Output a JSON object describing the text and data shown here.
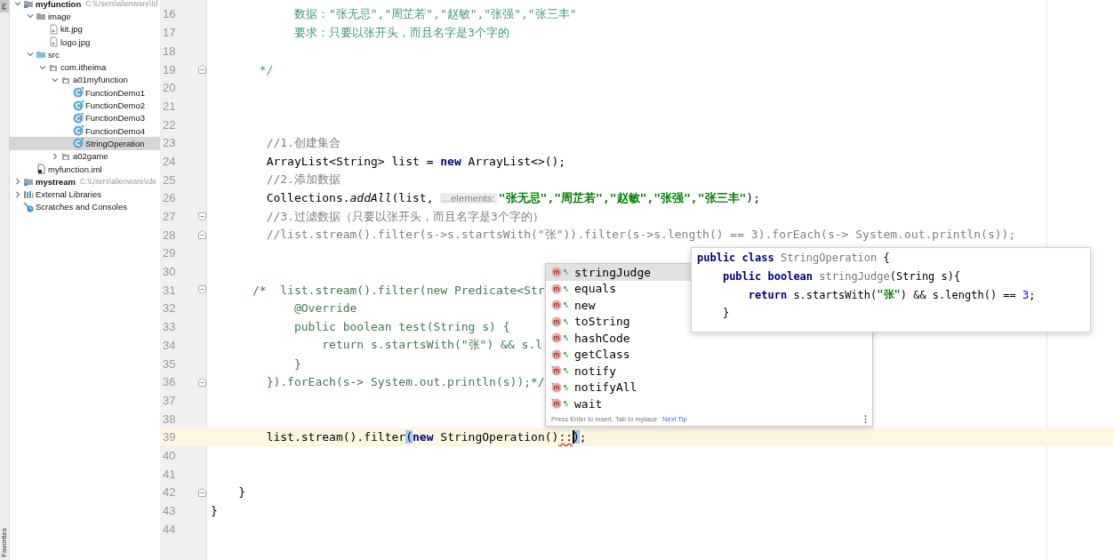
{
  "tool_stripe": {
    "top_tab": {
      "label": "Pr",
      "selected": true
    },
    "bottom_tab": {
      "label": "Favorites",
      "selected": false
    }
  },
  "project_tree": [
    {
      "label": "myfunction",
      "path": "C:\\Users\\alienware\\Id",
      "kind": "module",
      "expanded": true,
      "selected": false,
      "children": [
        {
          "label": "image",
          "kind": "folder",
          "expanded": true,
          "selected": false,
          "children": [
            {
              "label": "kit.jpg",
              "kind": "image",
              "selected": false
            },
            {
              "label": "logo.jpg",
              "kind": "image",
              "selected": false
            }
          ]
        },
        {
          "label": "src",
          "kind": "source-folder",
          "expanded": true,
          "selected": false,
          "children": [
            {
              "label": "com.itheima",
              "kind": "package",
              "expanded": true,
              "selected": false,
              "children": [
                {
                  "label": "a01myfunction",
                  "kind": "package",
                  "expanded": true,
                  "selected": false,
                  "children": [
                    {
                      "label": "FunctionDemo1",
                      "kind": "class",
                      "selected": false
                    },
                    {
                      "label": "FunctionDemo2",
                      "kind": "class",
                      "selected": false
                    },
                    {
                      "label": "FunctionDemo3",
                      "kind": "class",
                      "selected": false
                    },
                    {
                      "label": "FunctionDemo4",
                      "kind": "class",
                      "selected": false
                    },
                    {
                      "label": "StringOperation",
                      "kind": "class",
                      "selected": true
                    }
                  ]
                },
                {
                  "label": "a02game",
                  "kind": "package",
                  "expanded": false,
                  "selected": false
                }
              ]
            }
          ]
        },
        {
          "label": "myfunction.iml",
          "kind": "iml",
          "selected": false
        }
      ]
    },
    {
      "label": "mystream",
      "path": "C:\\Users\\alienware\\Ide",
      "kind": "module",
      "expanded": false,
      "selected": false
    },
    {
      "label": "External Libraries",
      "kind": "libraries",
      "expanded": false,
      "selected": false
    },
    {
      "label": "Scratches and Consoles",
      "kind": "scratches",
      "selected": false
    }
  ],
  "code_lines": [
    {
      "number": "16",
      "current": false,
      "tokens": [
        {
          "kind": "doc",
          "text": "            数据：\"张无忌\",\"周芷若\",\"赵敏\",\"张强\",\"张三丰\""
        }
      ]
    },
    {
      "number": "17",
      "current": false,
      "tokens": [
        {
          "kind": "doc",
          "text": "            要求：只要以张开头，而且名字是3个字的"
        }
      ]
    },
    {
      "number": "18",
      "current": false
    },
    {
      "number": "19",
      "current": false,
      "fold_end": true,
      "tokens": [
        {
          "kind": "doc",
          "text": "       */"
        }
      ]
    },
    {
      "number": "20",
      "current": false
    },
    {
      "number": "21",
      "current": false
    },
    {
      "number": "22",
      "current": false
    },
    {
      "number": "23",
      "current": false,
      "tokens": [
        {
          "kind": "comment",
          "text": "        //1.创建集合"
        }
      ]
    },
    {
      "number": "24",
      "current": false,
      "tokens": [
        {
          "kind": "plain",
          "text": "        ArrayList<String> list = "
        },
        {
          "kind": "keyword",
          "text": "new"
        },
        {
          "kind": "plain",
          "text": " ArrayList<>();"
        }
      ]
    },
    {
      "number": "25",
      "current": false,
      "tokens": [
        {
          "kind": "comment",
          "text": "        //2.添加数据"
        }
      ]
    },
    {
      "number": "26",
      "current": false,
      "tokens": [
        {
          "kind": "plain",
          "text": "        Collections."
        },
        {
          "kind": "static",
          "text": "addAll"
        },
        {
          "kind": "plain",
          "text": "(list, "
        },
        {
          "kind": "hint",
          "text": "...elements:"
        },
        {
          "kind": "string",
          "text": "\"张无忌\",\"周芷若\",\"赵敏\",\"张强\",\"张三丰\""
        },
        {
          "kind": "plain",
          "text": ");"
        }
      ]
    },
    {
      "number": "27",
      "current": false,
      "fold_start": true,
      "tokens": [
        {
          "kind": "comment",
          "text": "        //3.过滤数据（只要以张开头，而且名字是3个字的）"
        }
      ]
    },
    {
      "number": "28",
      "current": false,
      "fold_end": true,
      "tokens": [
        {
          "kind": "comment",
          "text": "        //list.stream().filter(s->s.startsWith(\"张\")).filter(s->s.length() == 3).forEach(s-> System.out.println(s));"
        }
      ]
    },
    {
      "number": "29",
      "current": false
    },
    {
      "number": "30",
      "current": false
    },
    {
      "number": "31",
      "current": false,
      "fold_start": true,
      "tokens": [
        {
          "kind": "block",
          "text": "      /*  list.stream().filter(new Predicate<Str"
        }
      ]
    },
    {
      "number": "32",
      "current": false,
      "tokens": [
        {
          "kind": "block",
          "text": "            @Override"
        }
      ]
    },
    {
      "number": "33",
      "current": false,
      "tokens": [
        {
          "kind": "block",
          "text": "            public boolean test(String s) {"
        }
      ]
    },
    {
      "number": "34",
      "current": false,
      "tokens": [
        {
          "kind": "block",
          "text": "                return s.startsWith(\"张\") && s.l"
        }
      ]
    },
    {
      "number": "35",
      "current": false,
      "tokens": [
        {
          "kind": "block",
          "text": "            }"
        }
      ]
    },
    {
      "number": "36",
      "current": false,
      "fold_end": true,
      "tokens": [
        {
          "kind": "block",
          "text": "        }).forEach(s-> System.out.println(s));*/"
        }
      ]
    },
    {
      "number": "37",
      "current": false
    },
    {
      "number": "38",
      "current": false
    },
    {
      "number": "39",
      "current": true,
      "tokens": [
        {
          "kind": "plain",
          "text": "        list.stream().filter"
        },
        {
          "kind": "brace",
          "text": "("
        },
        {
          "kind": "keyword",
          "text": "new"
        },
        {
          "kind": "plain",
          "text": " StringOperation()"
        },
        {
          "kind": "error",
          "text": "::"
        },
        {
          "kind": "brace",
          "text": ")",
          "caret": true
        },
        {
          "kind": "plain",
          "text": ";"
        }
      ]
    },
    {
      "number": "40",
      "current": false
    },
    {
      "number": "41",
      "current": false
    },
    {
      "number": "42",
      "current": false,
      "fold_end": true,
      "tokens": [
        {
          "kind": "plain",
          "text": "    }"
        }
      ]
    },
    {
      "number": "43",
      "current": false,
      "tokens": [
        {
          "kind": "plain",
          "text": "}"
        }
      ]
    },
    {
      "number": "44",
      "current": false
    }
  ],
  "completion_popup": {
    "items": [
      {
        "label": "stringJudge",
        "selected": true,
        "final": false
      },
      {
        "label": "equals",
        "selected": false,
        "final": false
      },
      {
        "label": "new",
        "selected": false,
        "final": false
      },
      {
        "label": "toString",
        "selected": false,
        "final": false
      },
      {
        "label": "hashCode",
        "selected": false,
        "final": false
      },
      {
        "label": "getClass",
        "selected": false,
        "final": false
      },
      {
        "label": "notify",
        "selected": false,
        "final": true
      },
      {
        "label": "notifyAll",
        "selected": false,
        "final": true
      },
      {
        "label": "wait",
        "selected": false,
        "final": true
      }
    ],
    "footer_hint": "Press Enter to insert, Tab to replace",
    "footer_link": "Next Tip"
  },
  "documentation_popup": {
    "lines": [
      [
        {
          "kind": "keyword",
          "text": "public class "
        },
        {
          "kind": "method",
          "text": "StringOperation"
        },
        {
          "kind": "plain",
          "text": " {"
        }
      ],
      [
        {
          "kind": "keyword",
          "text": "    public boolean "
        },
        {
          "kind": "method",
          "text": "stringJudge"
        },
        {
          "kind": "plain",
          "text": "(String s){"
        }
      ],
      [
        {
          "kind": "keyword",
          "text": "        return "
        },
        {
          "kind": "plain",
          "text": "s.startsWith("
        },
        {
          "kind": "string",
          "text": "\"张\""
        },
        {
          "kind": "plain",
          "text": ") && s.length() == "
        },
        {
          "kind": "number",
          "text": "3"
        },
        {
          "kind": "plain",
          "text": ";"
        }
      ],
      [
        {
          "kind": "plain",
          "text": "    }"
        }
      ]
    ]
  }
}
